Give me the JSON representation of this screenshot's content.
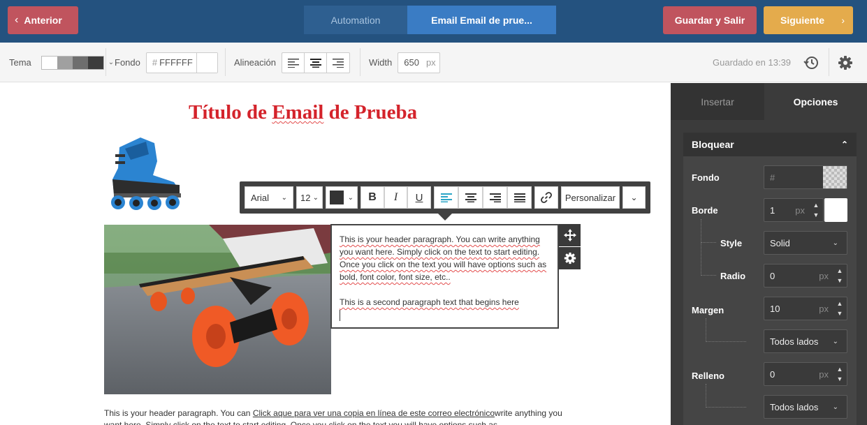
{
  "topbar": {
    "prev_label": "Anterior",
    "steps": [
      {
        "label": "Automation",
        "active": false
      },
      {
        "label": "Email Email de prue...",
        "active": true
      }
    ],
    "save_label": "Guardar y Salir",
    "next_label": "Siguiente"
  },
  "toolbar": {
    "theme_label": "Tema",
    "theme_swatches": [
      "#ffffff",
      "#a0a0a0",
      "#6e6e6e",
      "#3c3c3c"
    ],
    "bg_label": "Fondo",
    "bg_hash": "#",
    "bg_value": "FFFFFF",
    "align_label": "Alineación",
    "align_selected": "center",
    "width_label": "Width",
    "width_value": "650",
    "width_unit": "px",
    "saved_status": "Guardado en 13:39"
  },
  "email": {
    "title_parts": [
      "Título de ",
      "Email",
      " de Prueba"
    ],
    "text_block": {
      "p1": "This is your header paragraph. You can write anything you want here. Simply click on the text to start editing. Once you click on the text you will have options such as bold, font color, font size, etc..",
      "p2": "This is a second paragraph text that begins here"
    },
    "footer_pre": "This is your header paragraph. You can ",
    "footer_link": "Click aque para ver una copia en línea de este correo electrónico",
    "footer_post": "write anything you want here. Simply click on the text to start editing. Once you click on the text you will have options such as"
  },
  "format_toolbar": {
    "font": "Arial",
    "size": "12",
    "bold": "B",
    "italic": "I",
    "underline": "U",
    "personalize_label": "Personalizar"
  },
  "panel": {
    "tabs": [
      {
        "label": "Insertar",
        "active": false
      },
      {
        "label": "Opciones",
        "active": true
      }
    ],
    "section_title": "Bloquear",
    "fondo_label": "Fondo",
    "fondo_placeholder": "#",
    "borde_label": "Borde",
    "borde_value": "1",
    "borde_unit": "px",
    "style_label": "Style",
    "style_value": "Solid",
    "radio_label": "Radio",
    "radio_value": "0",
    "radio_unit": "px",
    "margen_label": "Margen",
    "margen_value": "10",
    "margen_unit": "px",
    "margen_sides": "Todos lados",
    "relleno_label": "Relleno",
    "relleno_value": "0",
    "relleno_unit": "px",
    "relleno_sides": "Todos lados"
  },
  "colors": {
    "topbar": "#24527f",
    "danger": "#c0545e",
    "accent": "#e4ab4c",
    "title_red": "#d4232b",
    "align_active": "#2ba5c7"
  }
}
